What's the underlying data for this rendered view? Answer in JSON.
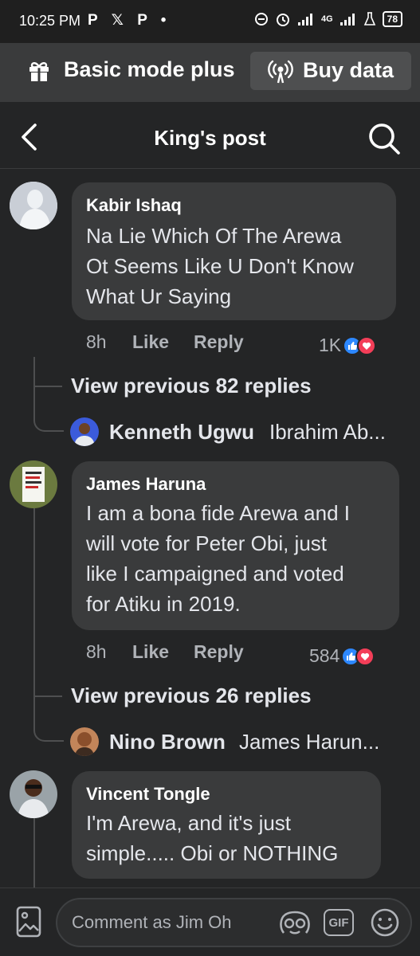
{
  "status_bar": {
    "time": "10:25 PM",
    "app_icons": "P 𝕏 P •",
    "network": "4G",
    "battery": "78"
  },
  "basic_mode": {
    "label": "Basic mode plus",
    "buy_label": "Buy data"
  },
  "header": {
    "title": "King's post"
  },
  "comments": [
    {
      "author": "Kabir Ishaq",
      "lines": [
        "Na Lie Which Of The Arewa",
        "Ot Seems Like U Don't Know",
        "What Ur Saying"
      ],
      "time": "8h",
      "like_label": "Like",
      "reply_label": "Reply",
      "reactions": "1K",
      "view_previous": "View previous 82 replies",
      "reply_author": "Kenneth Ugwu",
      "reply_preview": "Ibrahim Ab..."
    },
    {
      "author": "James Haruna",
      "lines": [
        "I am a bona fide Arewa and I",
        "will vote for Peter Obi, just",
        "like I campaigned and voted",
        "for Atiku in 2019."
      ],
      "time": "8h",
      "like_label": "Like",
      "reply_label": "Reply",
      "reactions": "584",
      "view_previous": "View previous 26 replies",
      "reply_author": "Nino Brown",
      "reply_preview": "James Harun..."
    },
    {
      "author": "Vincent Tongle",
      "lines": [
        "I'm Arewa, and it's just",
        "simple..... Obi or NOTHING"
      ]
    }
  ],
  "composer": {
    "placeholder": "Comment as Jim Oh",
    "gif_label": "GIF"
  },
  "colors": {
    "background": "#242526",
    "bubble": "#3a3b3c",
    "like_blue": "#2d88ff",
    "love_red": "#f33e58"
  }
}
